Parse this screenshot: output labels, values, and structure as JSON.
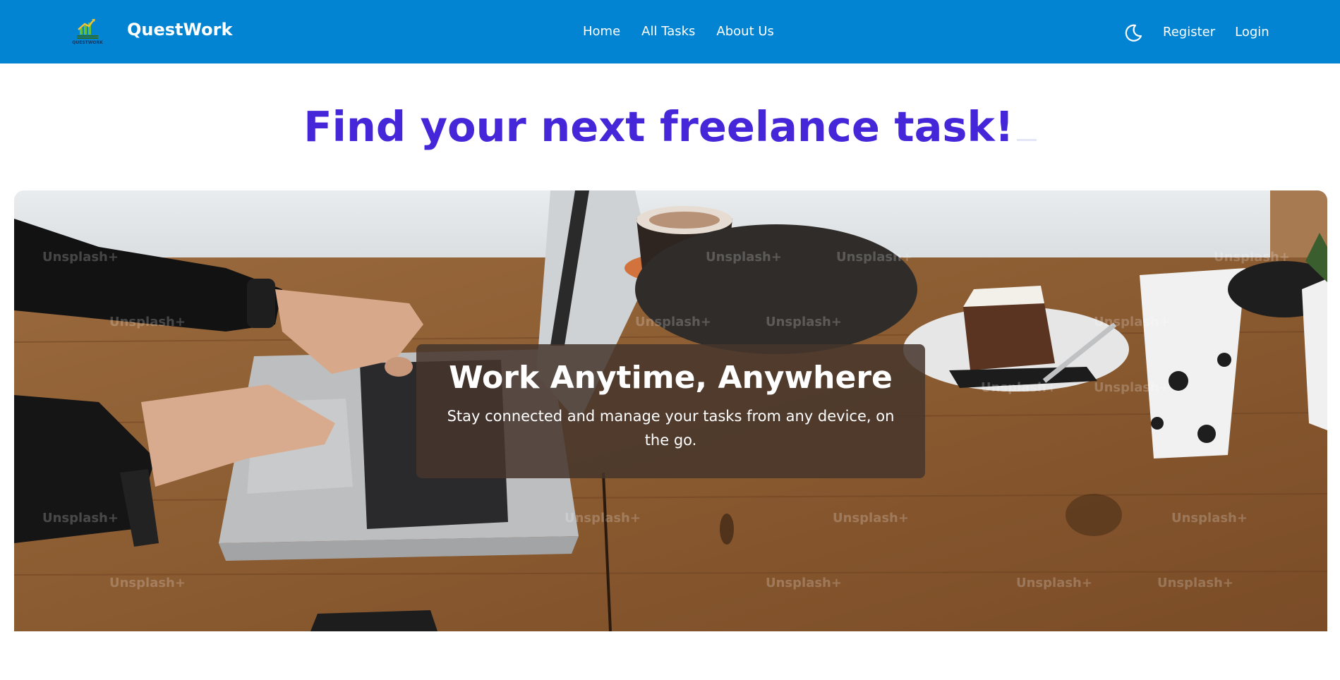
{
  "navbar": {
    "logo_text": "QUESTWORK",
    "brand": "QuestWork",
    "links": [
      "Home",
      "All Tasks",
      "About Us"
    ],
    "theme_icon": "moon-icon",
    "register_label": "Register",
    "login_label": "Login",
    "background": "#0284d2"
  },
  "hero": {
    "headline": "Find your next freelance task!",
    "headline_color": "#4526d9",
    "banner_title": "Work Anytime, Anywhere",
    "banner_text": "Stay connected and manage your tasks from any device, on the go.",
    "watermark": "Unsplash+"
  }
}
